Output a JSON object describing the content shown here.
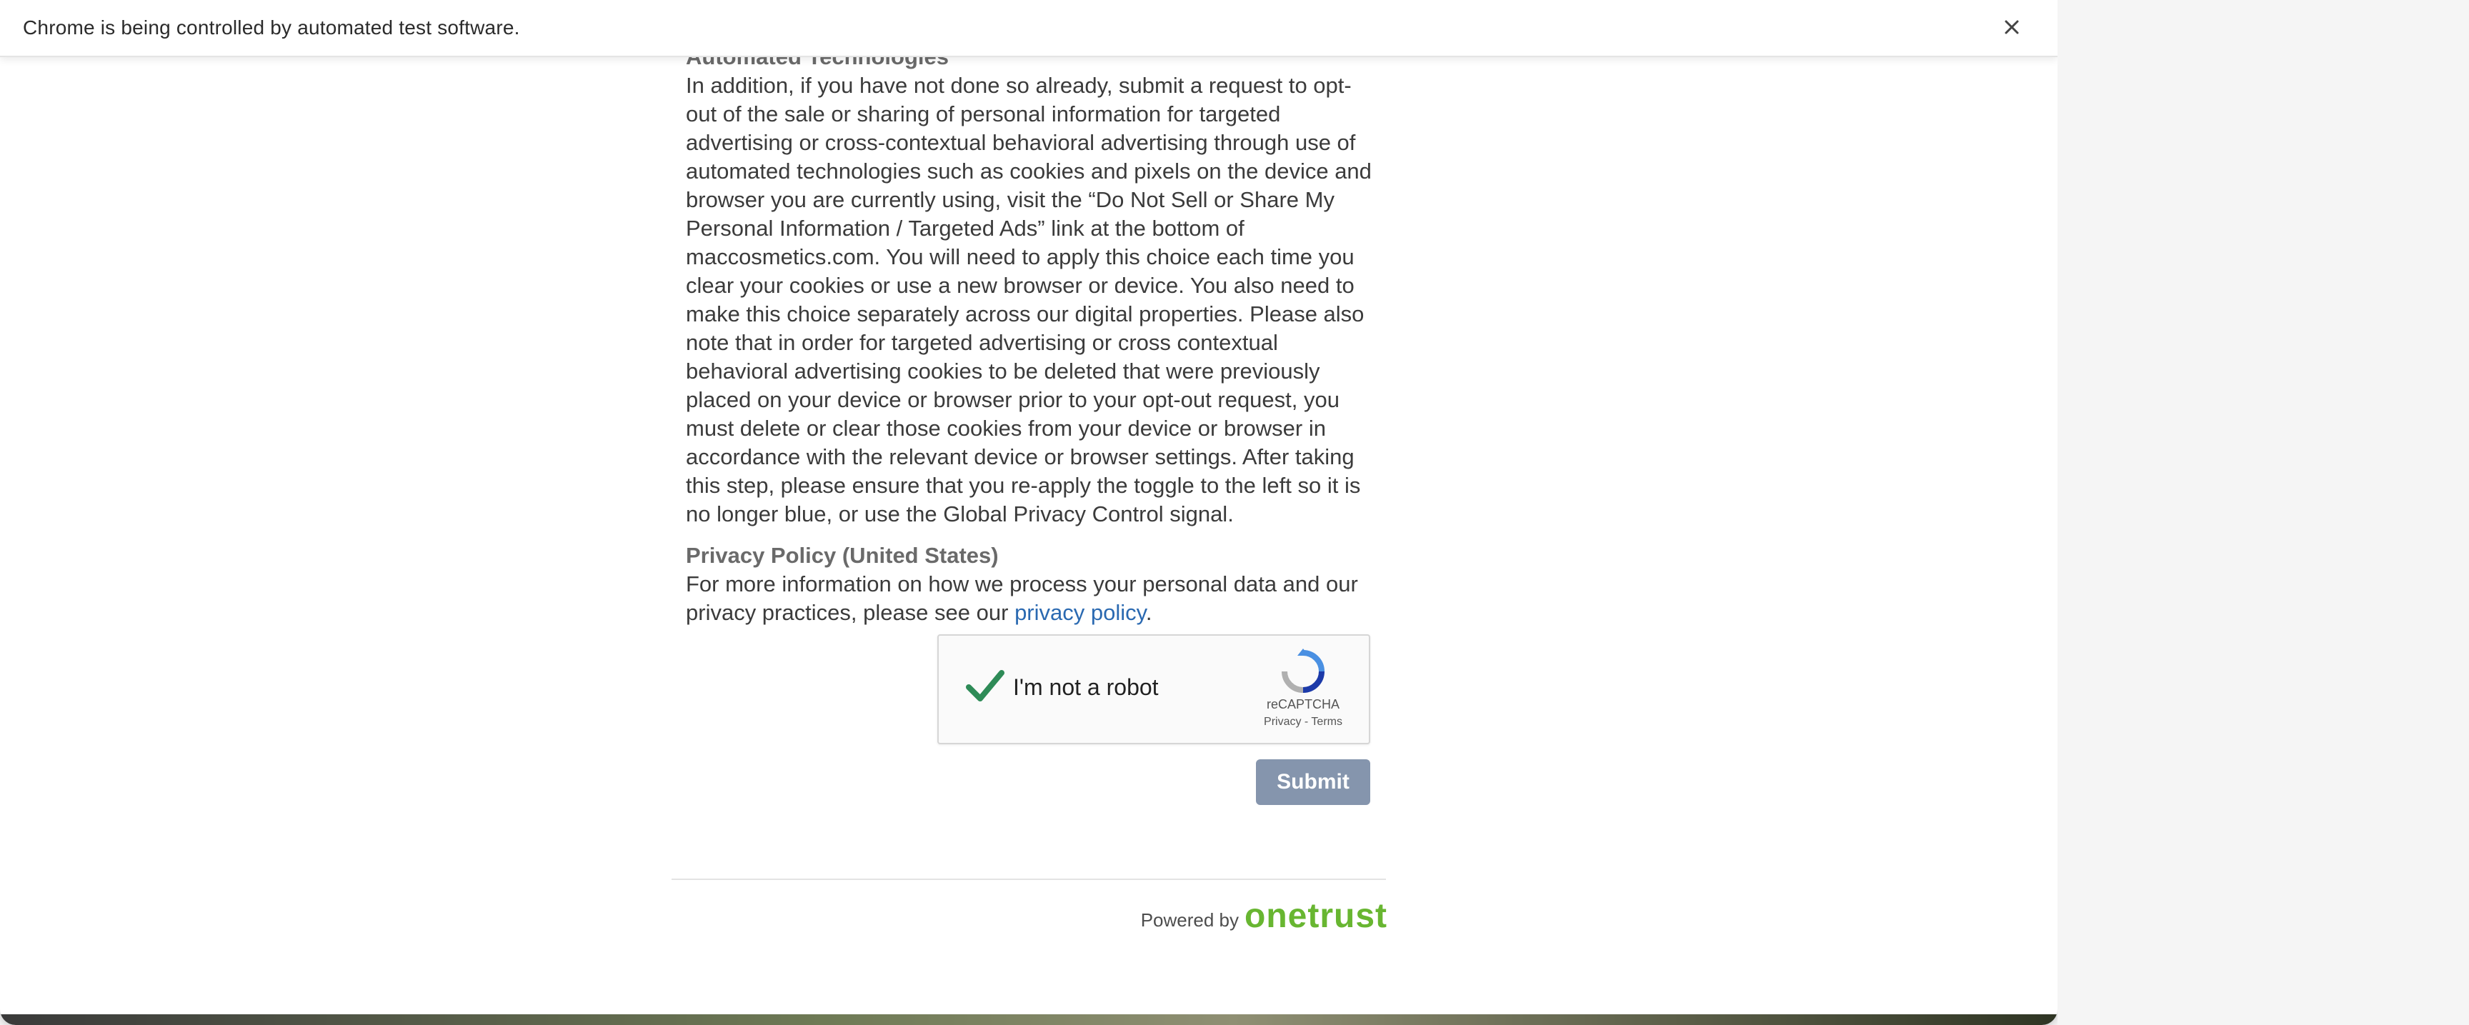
{
  "infobar": {
    "text": "Chrome is being controlled by automated test software.",
    "close_icon": "close-icon"
  },
  "content": {
    "heading": "Automated Technologies",
    "paragraph": "In addition, if you have not done so already, submit a request to opt-out of the sale or sharing of personal information for targeted advertising or cross-contextual behavioral advertising through use of automated technologies such as cookies and pixels on the device and browser you are currently using, visit the “Do Not Sell or Share My Personal Information / Targeted Ads” link at the bottom of maccosmetics.com. You will need to apply this choice each time you clear your cookies or use a new browser or device. You also need to make this choice separately across our digital properties. Please also note that in order for targeted advertising or cross contextual behavioral advertising cookies to be deleted that were previously placed on your device or browser prior to your opt-out request, you must delete or clear those cookies from your device or browser in accordance with the relevant device or browser settings. After taking this step, please ensure that you re-apply the toggle to the left so it is no longer blue, or use the Global Privacy Control signal.",
    "privacy_title": "Privacy Policy (United States)",
    "privacy_text_pre": "For more information on how we process your personal data and our privacy practices, please see our ",
    "privacy_link": "privacy policy",
    "privacy_text_post": "."
  },
  "captcha": {
    "label": "I'm not a robot",
    "brand": "reCAPTCHA",
    "links": "Privacy - Terms",
    "check_icon": "checkmark-icon",
    "logo_icon": "recaptcha-logo-icon",
    "checked": true
  },
  "submit": {
    "label": "Submit"
  },
  "footer": {
    "powered_by": "Powered by",
    "logo_text": "onetrust"
  },
  "colors": {
    "submit_bg": "#8595ad",
    "link": "#2a69b1",
    "onetrust_green": "#68b631",
    "check_green": "#2e8b57"
  }
}
